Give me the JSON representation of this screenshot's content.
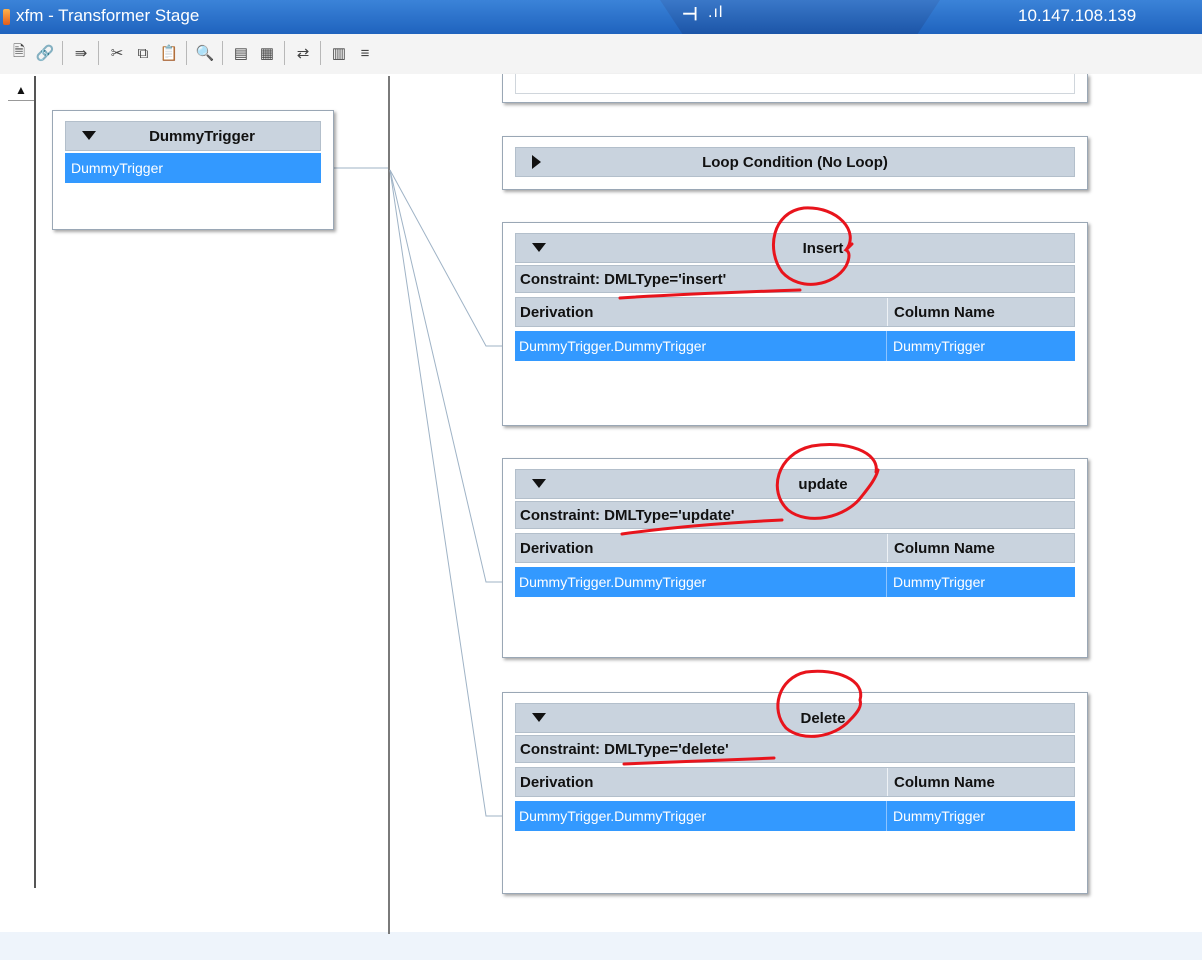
{
  "window": {
    "title": "xfm - Transformer Stage",
    "ip": "10.147.108.139",
    "pin_glyph": "⊣",
    "signal_glyph": ".ıl"
  },
  "toolbar": {
    "buttons": [
      {
        "name": "properties-icon",
        "glyph": "🗎"
      },
      {
        "name": "link-icon",
        "glyph": "🔗"
      },
      {
        "name": "column-auto-match-icon",
        "glyph": "⇛"
      },
      {
        "name": "cut-icon",
        "glyph": "✂"
      },
      {
        "name": "copy-icon",
        "glyph": "⧉"
      },
      {
        "name": "paste-icon",
        "glyph": "📋"
      },
      {
        "name": "find-icon",
        "glyph": "🔍"
      },
      {
        "name": "load-icon",
        "glyph": "▤"
      },
      {
        "name": "save-icon",
        "glyph": "▦"
      },
      {
        "name": "link-execution-order-icon",
        "glyph": "⇄"
      },
      {
        "name": "show-columns-icon",
        "glyph": "▥"
      },
      {
        "name": "input-link-order-icon",
        "glyph": "≡"
      }
    ]
  },
  "scrollbar": {
    "up_glyph": "▲"
  },
  "source_link": {
    "title": "DummyTrigger",
    "rows": [
      "DummyTrigger"
    ]
  },
  "loop_condition": {
    "title": "Loop Condition (No Loop)"
  },
  "output_links": [
    {
      "title": "Insert",
      "constraint": "Constraint: DMLType='insert'",
      "columns": [
        "Derivation",
        "Column Name"
      ],
      "rows": [
        [
          "DummyTrigger.DummyTrigger",
          "DummyTrigger"
        ]
      ]
    },
    {
      "title": "update",
      "constraint": "Constraint: DMLType='update'",
      "columns": [
        "Derivation",
        "Column Name"
      ],
      "rows": [
        [
          "DummyTrigger.DummyTrigger",
          "DummyTrigger"
        ]
      ]
    },
    {
      "title": "Delete",
      "constraint": "Constraint: DMLType='delete'",
      "columns": [
        "Derivation",
        "Column Name"
      ],
      "rows": [
        [
          "DummyTrigger.DummyTrigger",
          "DummyTrigger"
        ]
      ]
    }
  ],
  "colors": {
    "title_bar": "#1f63be",
    "selection": "#3399ff",
    "header_fill": "#c9d3de",
    "annotation": "#e8141c"
  }
}
